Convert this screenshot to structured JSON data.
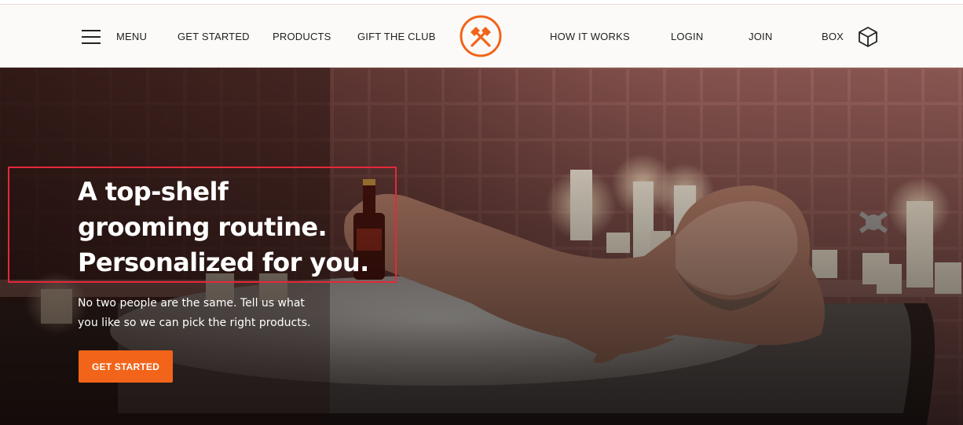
{
  "nav": {
    "menu_label": "MENU",
    "links": {
      "get_started": "GET STARTED",
      "products": "PRODUCTS",
      "gift": "GIFT THE CLUB",
      "how_it_works": "HOW IT WORKS",
      "login": "LOGIN",
      "join": "JOIN",
      "box": "BOX"
    },
    "icons": {
      "menu": "hamburger-icon",
      "logo": "crossed-hammers-logo",
      "box": "cube-icon"
    }
  },
  "hero": {
    "headline": [
      "A top-shelf",
      "grooming routine.",
      "Personalized for you."
    ],
    "subtext": [
      "No two people are the same. Tell us what",
      "you like so we can pick the right products."
    ],
    "cta_label": "GET STARTED"
  },
  "colors": {
    "accent": "#f26419",
    "highlight_box": "#e6283a",
    "nav_background": "#fbfaf8",
    "text_dark": "#222222"
  }
}
